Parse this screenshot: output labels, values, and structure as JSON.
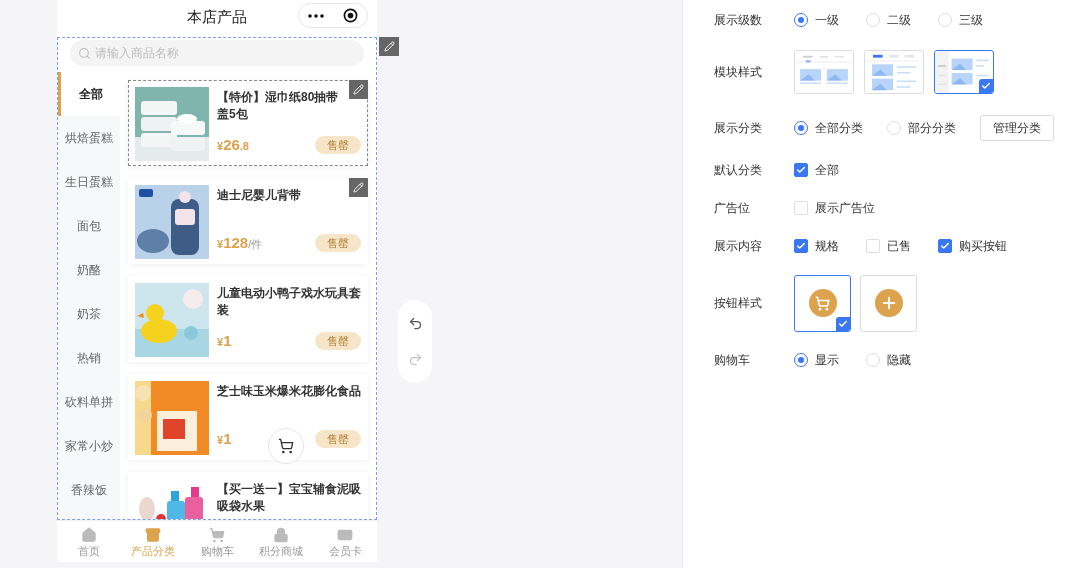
{
  "phone": {
    "title": "本店产品",
    "search": {
      "placeholder": "请输入商品名称"
    },
    "categories": [
      {
        "label": "全部",
        "selected": true
      },
      {
        "label": "烘焙蛋糕",
        "selected": false
      },
      {
        "label": "生日蛋糕",
        "selected": false
      },
      {
        "label": "面包",
        "selected": false
      },
      {
        "label": "奶酪",
        "selected": false
      },
      {
        "label": "奶茶",
        "selected": false
      },
      {
        "label": "热销",
        "selected": false
      },
      {
        "label": "砍料单拼",
        "selected": false
      },
      {
        "label": "家常小炒",
        "selected": false
      },
      {
        "label": "香辣饭",
        "selected": false
      }
    ],
    "products": [
      {
        "title": "【特价】湿巾纸80抽带盖5包",
        "currency": "¥",
        "price": "26",
        "fraction": ".8",
        "button": "售罄",
        "selected": true,
        "editable": true
      },
      {
        "title": "迪士尼婴儿背带",
        "currency": "¥",
        "price": "128",
        "unit": "/件",
        "button": "售罄",
        "selected": false,
        "editable": true
      },
      {
        "title": "儿童电动小鸭子戏水玩具套装",
        "currency": "¥",
        "price": "1",
        "button": "售罄",
        "selected": false,
        "editable": false
      },
      {
        "title": "芝士味玉米爆米花膨化食品",
        "currency": "¥",
        "price": "1",
        "button": "售罄",
        "selected": false,
        "editable": false
      },
      {
        "title": "【买一送一】宝宝辅食泥吸吸袋水果",
        "selected": false,
        "editable": false
      }
    ],
    "tabs": [
      {
        "label": "首页",
        "selected": false
      },
      {
        "label": "产品分类",
        "selected": true
      },
      {
        "label": "购物车",
        "selected": false
      },
      {
        "label": "积分商城",
        "selected": false
      },
      {
        "label": "会员卡",
        "selected": false
      }
    ]
  },
  "settings": [
    {
      "kind": "radio",
      "label": "展示级数",
      "options": [
        {
          "label": "一级",
          "selected": true
        },
        {
          "label": "二级",
          "selected": false
        },
        {
          "label": "三级",
          "selected": false
        }
      ]
    },
    {
      "kind": "layout",
      "label": "模块样式",
      "options": [
        {
          "selected": false
        },
        {
          "selected": false
        },
        {
          "selected": true
        }
      ]
    },
    {
      "kind": "radio",
      "label": "展示分类",
      "options": [
        {
          "label": "全部分类",
          "selected": true
        },
        {
          "label": "部分分类",
          "selected": false
        }
      ],
      "action": "管理分类"
    },
    {
      "kind": "checkbox",
      "label": "默认分类",
      "options": [
        {
          "label": "全部",
          "checked": true
        }
      ]
    },
    {
      "kind": "checkbox",
      "label": "广告位",
      "options": [
        {
          "label": "展示广告位",
          "checked": false
        }
      ]
    },
    {
      "kind": "checkbox",
      "label": "展示内容",
      "options": [
        {
          "label": "规格",
          "checked": true
        },
        {
          "label": "已售",
          "checked": false
        },
        {
          "label": "购买按钮",
          "checked": true
        }
      ]
    },
    {
      "kind": "button_style",
      "label": "按钮样式",
      "options": [
        {
          "selected": true
        },
        {
          "selected": false
        }
      ]
    },
    {
      "kind": "radio",
      "label": "购物车",
      "options": [
        {
          "label": "显示",
          "selected": true
        },
        {
          "label": "隐藏",
          "selected": false
        }
      ]
    }
  ]
}
